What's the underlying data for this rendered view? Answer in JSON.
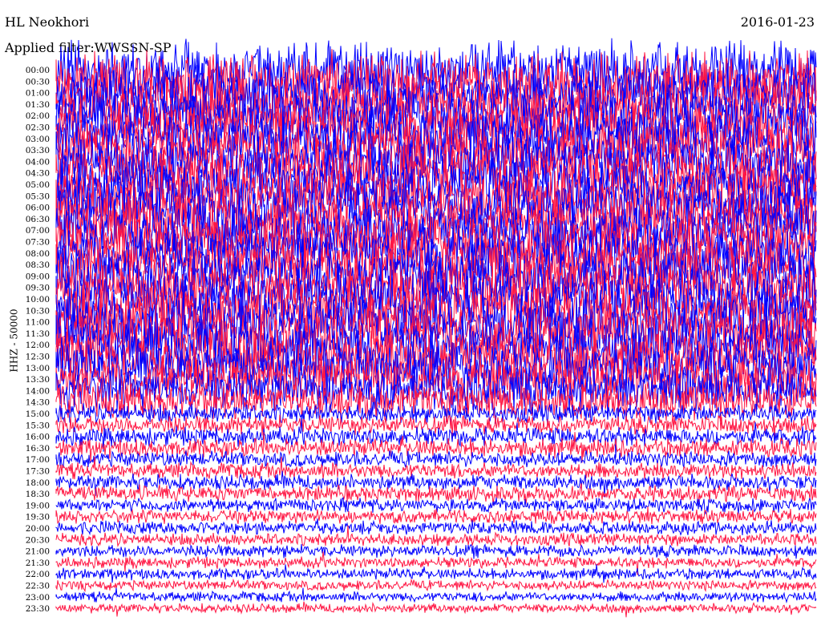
{
  "header": {
    "station": "HL Neokhori",
    "date": "2016-01-23",
    "filter": "Applied filter:WWSSN-SP"
  },
  "chart_data": {
    "type": "line",
    "title": "HL Neokhori",
    "date": "2016-01-23",
    "ylabel": "HHZ - 50000",
    "tick_labels": [
      "00:00",
      "00:30",
      "01:00",
      "01:30",
      "02:00",
      "02:30",
      "03:00",
      "03:30",
      "04:00",
      "04:30",
      "05:00",
      "05:30",
      "06:00",
      "06:30",
      "07:00",
      "07:30",
      "08:00",
      "08:30",
      "09:00",
      "09:30",
      "10:00",
      "10:30",
      "11:00",
      "11:30",
      "12:00",
      "12:30",
      "13:00",
      "13:30",
      "14:00",
      "14:30",
      "15:00",
      "15:30",
      "16:00",
      "16:30",
      "17:00",
      "17:30",
      "18:00",
      "18:30",
      "19:00",
      "19:30",
      "20:00",
      "20:30",
      "21:00",
      "21:30",
      "22:00",
      "22:30",
      "23:00",
      "23:30"
    ],
    "trace_colors": [
      "#0000ff",
      "#ff1744"
    ],
    "amplitude_level_by_row": [
      9,
      9,
      9,
      9,
      9,
      9,
      9,
      9,
      9,
      9,
      9,
      9,
      9,
      9,
      9,
      9,
      9,
      9,
      9,
      9,
      9,
      9,
      9,
      9,
      9,
      9,
      8,
      8,
      7,
      6,
      3,
      3,
      3,
      3,
      2.5,
      2.5,
      2.5,
      2.5,
      2.2,
      2.2,
      2.2,
      2,
      2,
      1.8,
      1.8,
      1.6,
      1.6,
      1.5
    ],
    "grid": false
  }
}
